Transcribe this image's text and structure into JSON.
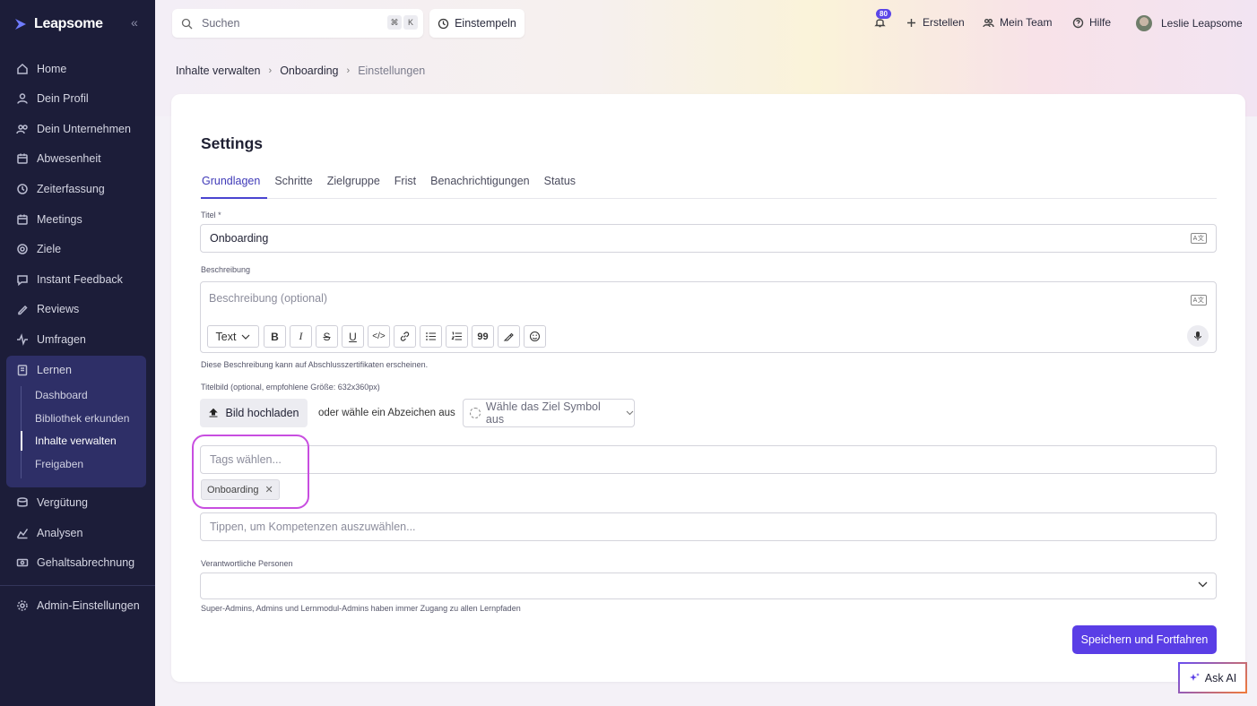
{
  "app": {
    "brand": "Leapsome"
  },
  "sidebar": {
    "items": [
      {
        "label": "Home",
        "icon": "home-icon"
      },
      {
        "label": "Dein Profil",
        "icon": "user-icon"
      },
      {
        "label": "Dein Unternehmen",
        "icon": "people-icon"
      },
      {
        "label": "Abwesenheit",
        "icon": "calendar-icon"
      },
      {
        "label": "Zeiterfassung",
        "icon": "clock-icon"
      },
      {
        "label": "Meetings",
        "icon": "calendar-icon"
      },
      {
        "label": "Ziele",
        "icon": "target-icon"
      },
      {
        "label": "Instant Feedback",
        "icon": "chat-icon"
      },
      {
        "label": "Reviews",
        "icon": "pen-icon"
      },
      {
        "label": "Umfragen",
        "icon": "pulse-icon"
      },
      {
        "label": "Lernen",
        "icon": "book-icon"
      }
    ],
    "learn_sub": [
      {
        "label": "Dashboard"
      },
      {
        "label": "Bibliothek erkunden"
      },
      {
        "label": "Inhalte verwalten"
      },
      {
        "label": "Freigaben"
      }
    ],
    "lower_items": [
      {
        "label": "Vergütung",
        "icon": "coin-icon"
      },
      {
        "label": "Analysen",
        "icon": "chart-icon"
      },
      {
        "label": "Gehaltsabrechnung",
        "icon": "cash-icon"
      }
    ],
    "admin": {
      "label": "Admin-Einstellungen",
      "icon": "gear-icon"
    }
  },
  "topbar": {
    "search_placeholder": "Suchen",
    "kbd1": "⌘",
    "kbd2": "K",
    "clock_in": "Einstempeln",
    "notifications_count": "80",
    "create": "Erstellen",
    "my_team": "Mein Team",
    "help": "Hilfe",
    "user": "Leslie Leapsome"
  },
  "breadcrumb": [
    "Inhalte verwalten",
    "Onboarding",
    "Einstellungen"
  ],
  "page": {
    "title": "Settings",
    "tabs": [
      "Grundlagen",
      "Schritte",
      "Zielgruppe",
      "Frist",
      "Benachrichtigungen",
      "Status"
    ],
    "title_label": "Titel *",
    "title_value": "Onboarding",
    "translate_icon_text": "A文",
    "description_label": "Beschreibung",
    "description_placeholder": "Beschreibung (optional)",
    "toolbar_text_select": "Text",
    "description_hint": "Diese Beschreibung kann auf Abschlusszertifikaten erscheinen.",
    "cover_label": "Titelbild (optional, empfohlene Größe: 632x360px)",
    "upload_button": "Bild hochladen",
    "or_text": "oder wähle ein Abzeichen aus",
    "badge_select_placeholder": "Wähle das Ziel Symbol aus",
    "tags_placeholder": "Tags wählen...",
    "tag_chip": "Onboarding",
    "skills_placeholder": "Tippen, um Kompetenzen auszuwählen...",
    "responsible_label": "Verantwortliche Personen",
    "responsible_hint": "Super-Admins, Admins und Lernmodul-Admins haben immer Zugang zu allen Lernpfaden",
    "save_button": "Speichern und Fortfahren",
    "ask_ai": "Ask AI"
  },
  "colors": {
    "sidebar_bg": "#1c1d39",
    "accent": "#5a3ee6",
    "highlight": "#c84ee0"
  }
}
